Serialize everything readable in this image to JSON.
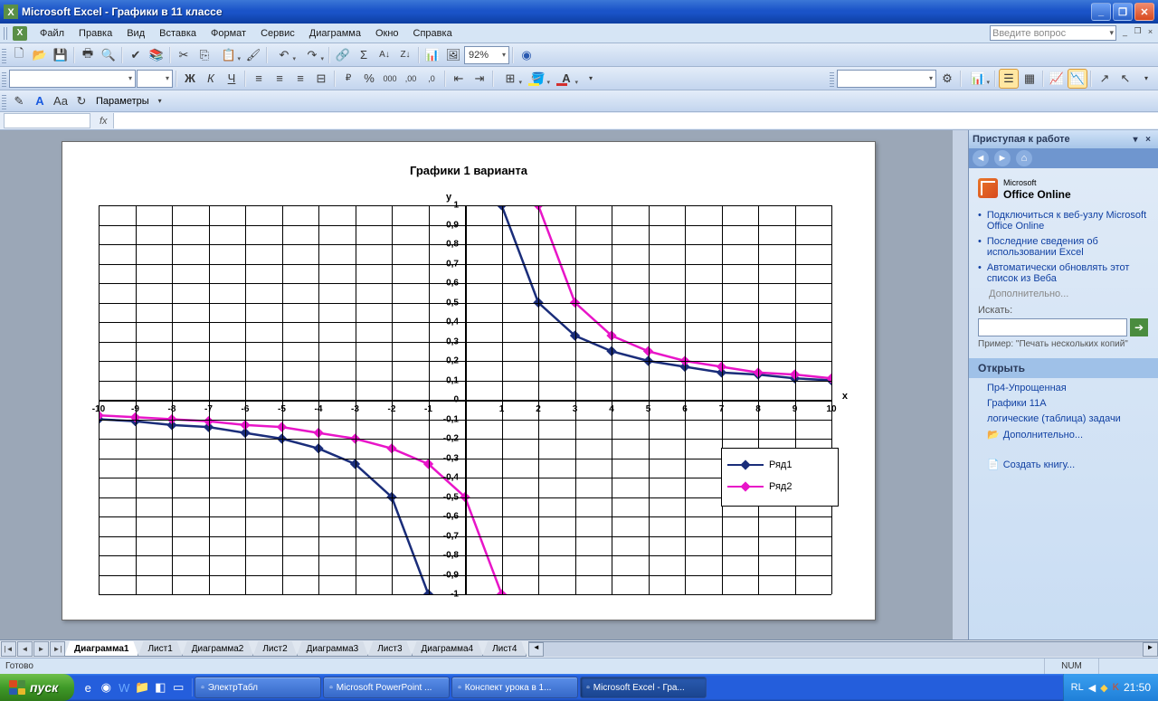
{
  "window": {
    "title": "Microsoft Excel - Графики в 11 классе"
  },
  "menu": {
    "file": "Файл",
    "edit": "Правка",
    "view": "Вид",
    "insert": "Вставка",
    "format": "Формат",
    "service": "Сервис",
    "diagram": "Диаграмма",
    "window": "Окно",
    "help": "Справка",
    "ask_placeholder": "Введите вопрос"
  },
  "tb": {
    "zoom": "92%",
    "font": "",
    "size": "",
    "params": "Параметры"
  },
  "sheet_tabs": [
    "Диаграмма1",
    "Лист1",
    "Диаграмма2",
    "Лист2",
    "Диаграмма3",
    "Лист3",
    "Диаграмма4",
    "Лист4"
  ],
  "status": {
    "ready": "Готово",
    "numlock": "NUM"
  },
  "taskpane": {
    "title": "Приступая к работе",
    "office": "Office Online",
    "office_ms": "Microsoft",
    "bullets": [
      "Подключиться к веб-узлу Microsoft Office Online",
      "Последние сведения об использовании Excel",
      "Автоматически обновлять этот список из Веба"
    ],
    "more": "Дополнительно...",
    "search_lbl": "Искать:",
    "example": "Пример: \"Печать нескольких копий\"",
    "open": "Открыть",
    "recent": [
      "Пр4-Упрощенная",
      "Графики 11А",
      "логические (таблица) задачи"
    ],
    "more2": "Дополнительно...",
    "create": "Создать книгу..."
  },
  "taskbar": {
    "start": "пуск",
    "tasks": [
      {
        "label": "ЭлектрТабл"
      },
      {
        "label": "Microsoft PowerPoint ..."
      },
      {
        "label": "Конспект урока в 1..."
      },
      {
        "label": "Microsoft Excel - Гра...",
        "active": true
      }
    ],
    "lang": "RL",
    "time": "21:50"
  },
  "chart_data": {
    "type": "line",
    "title": "Графики 1 варианта",
    "xlabel": "x",
    "ylabel": "y",
    "xlim": [
      -10,
      10
    ],
    "ylim": [
      -1,
      1
    ],
    "xticks": [
      -10,
      -9,
      -8,
      -7,
      -6,
      -5,
      -4,
      -3,
      -2,
      -1,
      0,
      1,
      2,
      3,
      4,
      5,
      6,
      7,
      8,
      9,
      10
    ],
    "yticks": [
      -1,
      -0.9,
      -0.8,
      -0.7,
      -0.6,
      -0.5,
      -0.4,
      -0.3,
      -0.2,
      -0.1,
      0,
      0.1,
      0.2,
      0.3,
      0.4,
      0.5,
      0.6,
      0.7,
      0.8,
      0.9,
      1
    ],
    "legend": [
      "Ряд1",
      "Ряд2"
    ],
    "series": [
      {
        "name": "Ряд1",
        "color": "#1a2d7a",
        "x": [
          -10,
          -9,
          -8,
          -7,
          -6,
          -5,
          -4,
          -3,
          -2,
          -1,
          1,
          2,
          3,
          4,
          5,
          6,
          7,
          8,
          9,
          10
        ],
        "y": [
          -0.1,
          -0.11,
          -0.13,
          -0.14,
          -0.17,
          -0.2,
          -0.25,
          -0.33,
          -0.5,
          -1.0,
          1.0,
          0.5,
          0.33,
          0.25,
          0.2,
          0.17,
          0.14,
          0.13,
          0.11,
          0.1
        ]
      },
      {
        "name": "Ряд2",
        "color": "#e815c8",
        "x": [
          -10,
          -9,
          -8,
          -7,
          -6,
          -5,
          -4,
          -3,
          -2,
          -1,
          0,
          1,
          2,
          3,
          4,
          5,
          6,
          7,
          8,
          9,
          10
        ],
        "y": [
          -0.08,
          -0.09,
          -0.1,
          -0.11,
          -0.13,
          -0.14,
          -0.17,
          -0.2,
          -0.25,
          -0.33,
          -0.5,
          -1.0,
          1.0,
          0.5,
          0.33,
          0.25,
          0.2,
          0.17,
          0.14,
          0.13,
          0.11
        ]
      }
    ]
  }
}
